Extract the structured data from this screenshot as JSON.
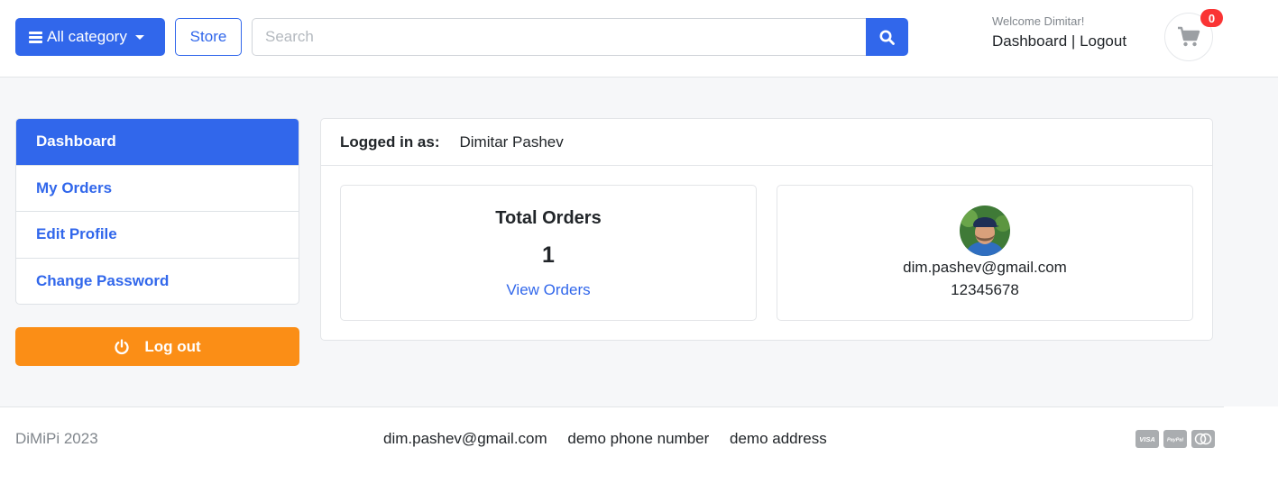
{
  "header": {
    "category_label": "All category",
    "store_label": "Store",
    "search_placeholder": "Search",
    "welcome_text": "Welcome Dimitar!",
    "dashboard_link": "Dashboard",
    "separator": "|",
    "logout_link": "Logout",
    "cart_count": "0"
  },
  "sidebar": {
    "items": [
      {
        "label": "Dashboard",
        "active": true
      },
      {
        "label": "My Orders",
        "active": false
      },
      {
        "label": "Edit Profile",
        "active": false
      },
      {
        "label": "Change Password",
        "active": false
      }
    ],
    "logout_label": "Log out"
  },
  "account": {
    "logged_in_label": "Logged in as:",
    "user_name": "Dimitar Pashev",
    "orders_title": "Total Orders",
    "orders_count": "1",
    "view_orders_label": "View Orders",
    "email": "dim.pashev@gmail.com",
    "phone": "12345678"
  },
  "footer": {
    "copyright": "DiMiPi 2023",
    "email": "dim.pashev@gmail.com",
    "phone": "demo phone number",
    "address": "demo address",
    "payment_icons": [
      "visa-icon",
      "paypal-icon",
      "mastercard-icon"
    ]
  },
  "colors": {
    "primary": "#3167eb",
    "warning": "#fb8e16",
    "badge": "#fa3434",
    "page_bg": "#f6f7f9"
  }
}
